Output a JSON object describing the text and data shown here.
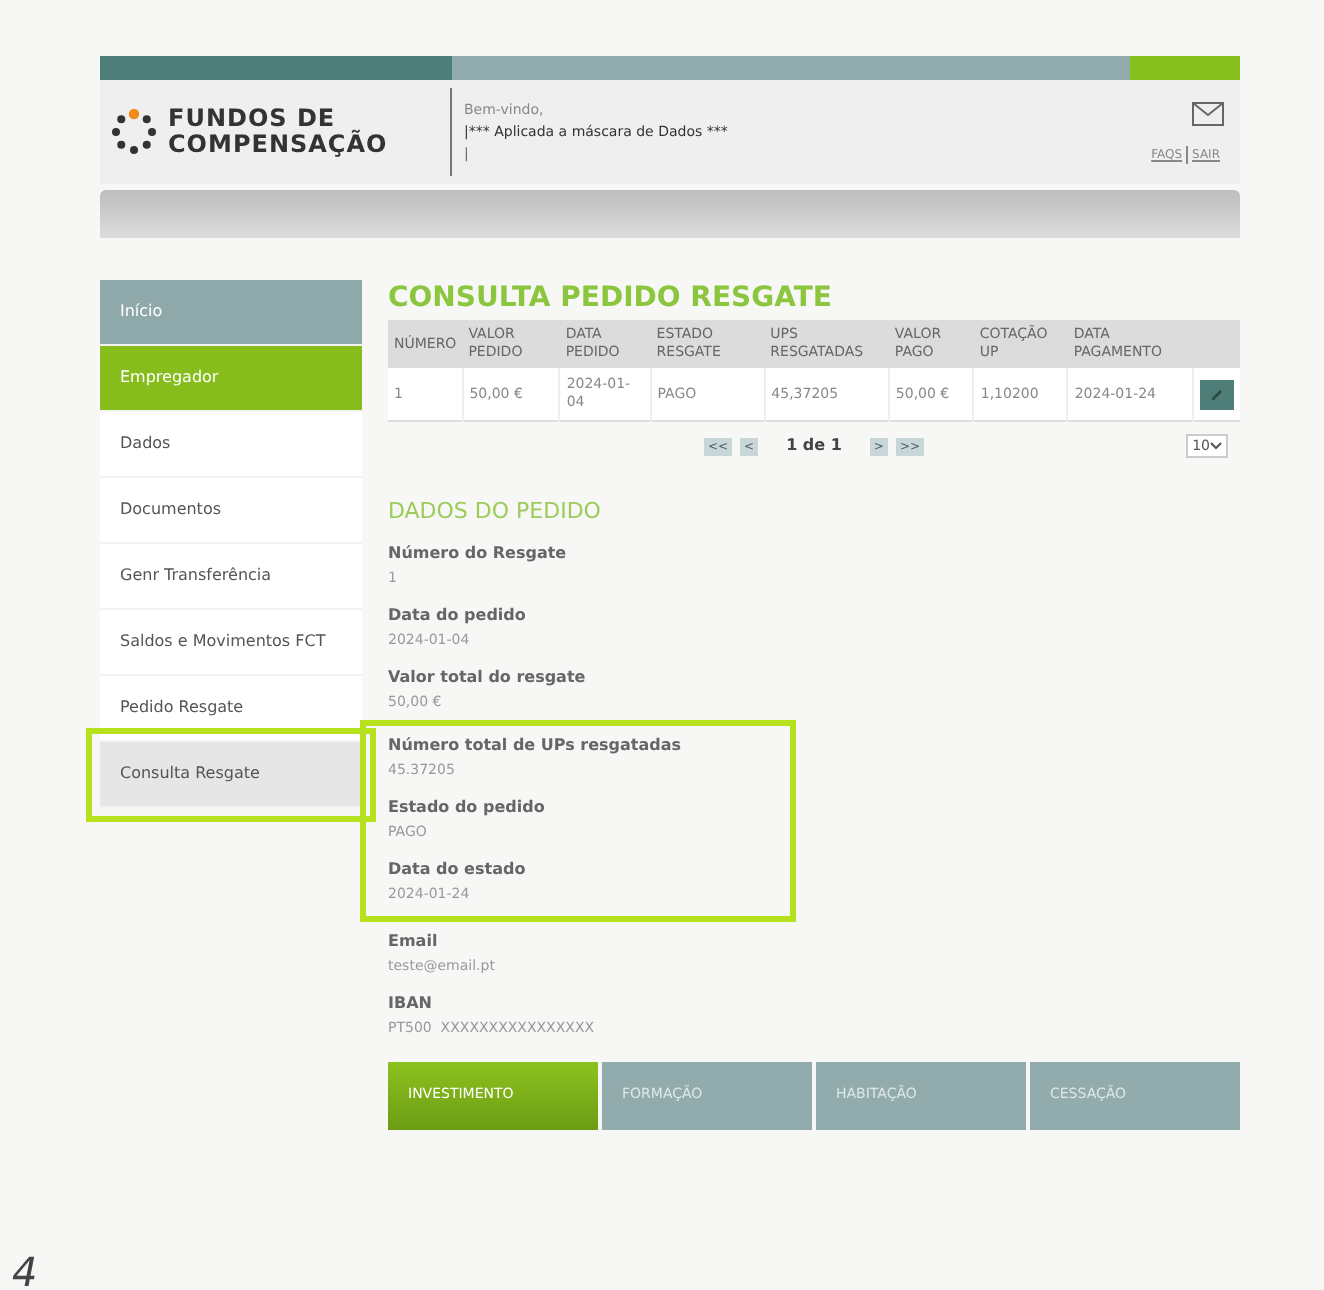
{
  "header": {
    "logo_line1": "FUNDOS DE",
    "logo_line2": "COMPENSAÇÃO",
    "welcome": "Bem-vindo,",
    "mask_notice": "|*** Aplicada a máscara de Dados ***",
    "cursor": "|",
    "links": [
      "FAQS",
      "SAIR"
    ]
  },
  "sidebar": {
    "items": [
      {
        "label": "Início",
        "kind": "section",
        "selected": false,
        "highlighted": false
      },
      {
        "label": "Empregador",
        "kind": "section",
        "selected": true,
        "highlighted": false
      },
      {
        "label": "Dados",
        "kind": "sub",
        "selected": false,
        "highlighted": false
      },
      {
        "label": "Documentos",
        "kind": "sub",
        "selected": false,
        "highlighted": false
      },
      {
        "label": "Genr Transferência",
        "kind": "sub",
        "selected": false,
        "highlighted": false
      },
      {
        "label": "Saldos e Movimentos FCT",
        "kind": "sub",
        "selected": false,
        "highlighted": false
      },
      {
        "label": "Pedido Resgate",
        "kind": "sub",
        "selected": false,
        "highlighted": false
      },
      {
        "label": "Consulta Resgate",
        "kind": "sub",
        "selected": true,
        "highlighted": true
      }
    ]
  },
  "page_title": "CONSULTA PEDIDO RESGATE",
  "table": {
    "columns": [
      "NÚMERO",
      "VALOR PEDIDO",
      "DATA PEDIDO",
      "ESTADO RESGATE",
      "UPS RESGATADAS",
      "VALOR PAGO",
      "COTAÇÃO UP",
      "DATA PAGAMENTO"
    ],
    "rows": [
      [
        "1",
        "50,00 €",
        "2024-01-04",
        "PAGO",
        "45,37205",
        "50,00 €",
        "1,10200",
        "2024-01-24"
      ]
    ]
  },
  "pagination": {
    "first": "<<",
    "prev": "<",
    "page": "1 de 1",
    "next": ">",
    "last": ">>",
    "page_size": "10"
  },
  "details": {
    "title": "DADOS DO PEDIDO",
    "fields": [
      {
        "label": "Número do Resgate",
        "value": "1",
        "highlighted": false
      },
      {
        "label": "Data do pedido",
        "value": "2024-01-04",
        "highlighted": false
      },
      {
        "label": "Valor total do resgate",
        "value": "50,00 €",
        "highlighted": false
      },
      {
        "label": "Número total de UPs resgatadas",
        "value": "45.37205",
        "highlighted": true
      },
      {
        "label": "Estado do pedido",
        "value": "PAGO",
        "highlighted": true
      },
      {
        "label": "Data do estado",
        "value": "2024-01-24",
        "highlighted": true
      },
      {
        "label": "Email",
        "value": "teste@email.pt",
        "highlighted": false
      },
      {
        "label": "IBAN",
        "value": "PT500  XXXXXXXXXXXXXXXX",
        "highlighted": false
      }
    ]
  },
  "footer_tabs": [
    {
      "label": "INVESTIMENTO",
      "selected": true
    },
    {
      "label": "FORMAÇÃO",
      "selected": false
    },
    {
      "label": "HABITAÇÃO",
      "selected": false
    },
    {
      "label": "CESSAÇÃO",
      "selected": false
    }
  ],
  "corner_mark": "4"
}
